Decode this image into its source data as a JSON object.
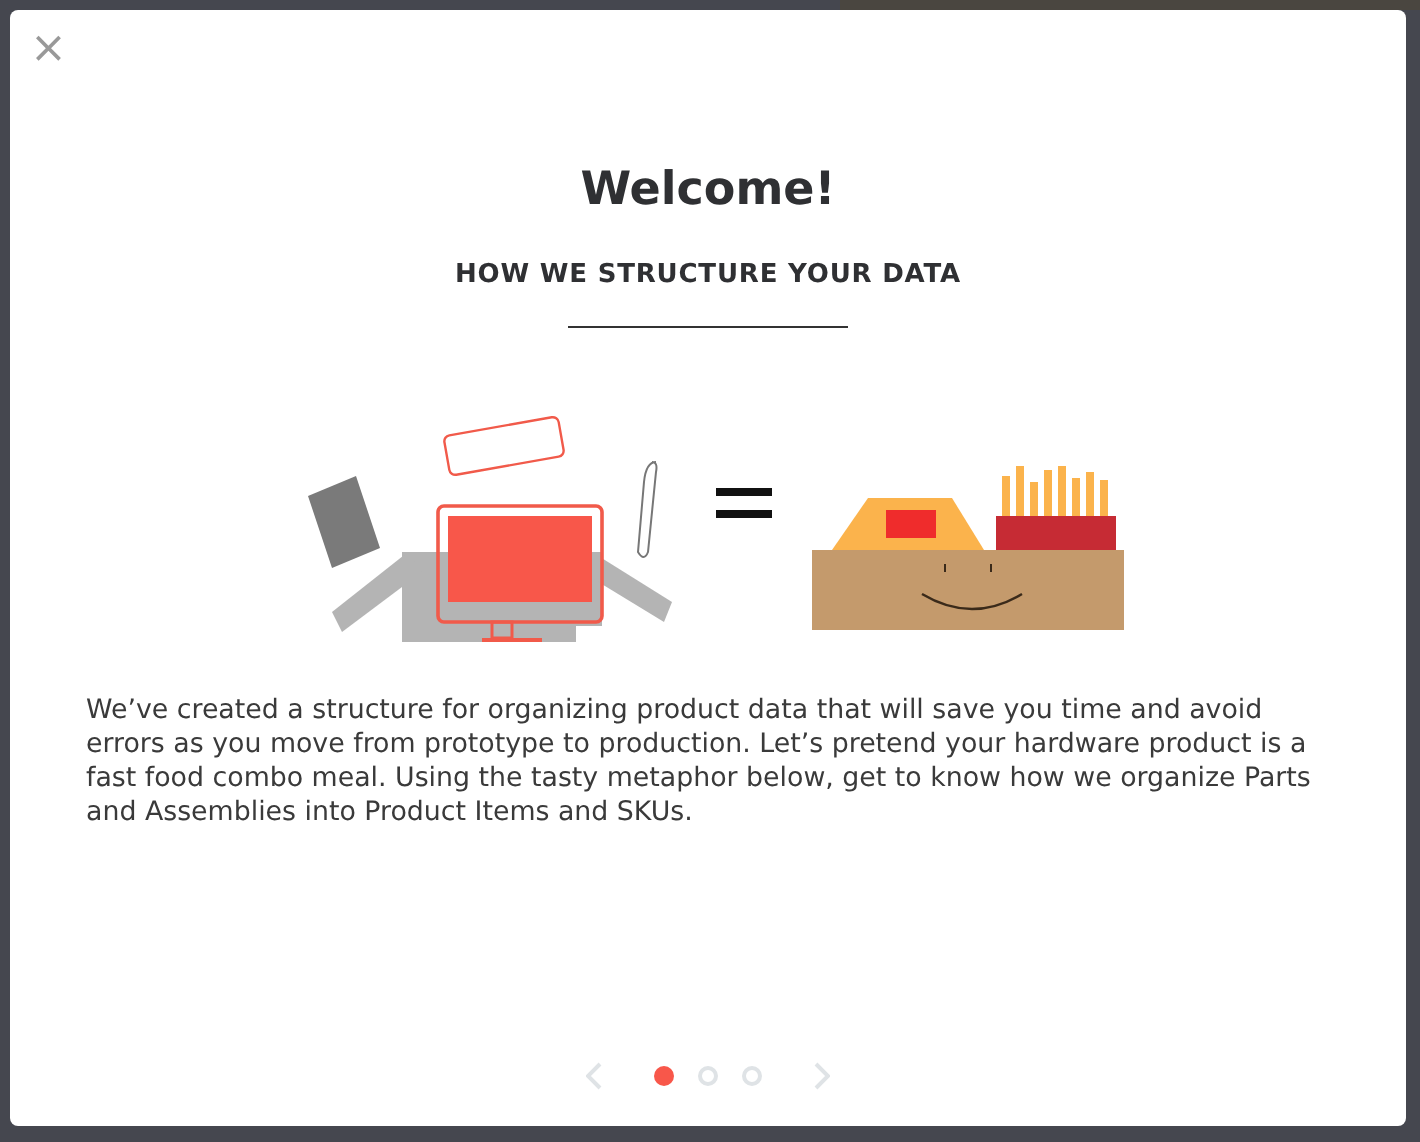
{
  "modal": {
    "close": "×",
    "title": "Welcome!",
    "subtitle": "HOW WE STRUCTURE YOUR DATA",
    "body": "We’ve created a structure for organizing product data that will save you time and avoid errors as you move from prototype to production. Let’s pretend your hardware product is a fast food combo meal. Using the tasty metaphor below, get to know how we organize Parts and Assemblies into Product Items and SKUs.",
    "pages": [
      {
        "selected": true
      },
      {
        "selected": false
      },
      {
        "selected": false
      }
    ]
  }
}
